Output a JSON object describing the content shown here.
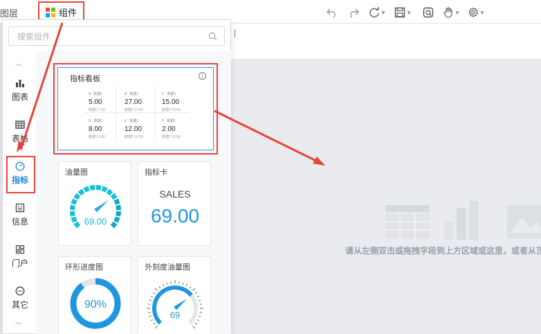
{
  "topbar": {
    "layers_label": "图层",
    "component_button_label": "组件",
    "tools": [
      "undo-icon",
      "redo-icon",
      "refresh-icon",
      "save-icon",
      "preview-icon",
      "hand-icon",
      "settings-icon"
    ]
  },
  "panel": {
    "search_placeholder": "搜索组件",
    "categories": [
      {
        "label": "图表",
        "icon": "chart-icon"
      },
      {
        "label": "表格",
        "icon": "table-icon"
      },
      {
        "label": "指标",
        "icon": "gauge-icon"
      },
      {
        "label": "信息",
        "icon": "info-icon"
      },
      {
        "label": "门户",
        "icon": "portal-icon"
      },
      {
        "label": "其它",
        "icon": "more-icon"
      }
    ],
    "active_category": "指标",
    "components": {
      "kpi_board": {
        "title": "指标看板",
        "cells": [
          {
            "letter": "A",
            "label": "数据1",
            "value": "5.00",
            "sub": "数据2 7.00"
          },
          {
            "letter": "B",
            "label": "数据1",
            "value": "27.00",
            "sub": "数据2 12.00"
          },
          {
            "letter": "C",
            "label": "数据1",
            "value": "15.00",
            "sub": "数据2 25.00"
          },
          {
            "letter": "D",
            "label": "数据1",
            "value": "8.00",
            "sub": "数据2 2.00"
          },
          {
            "letter": "E",
            "label": "数据1",
            "value": "12.00",
            "sub": "数据2 16.00"
          },
          {
            "letter": "F",
            "label": "数据1",
            "value": "2.00",
            "sub": "数据2 10.00"
          }
        ]
      },
      "gauge": {
        "title": "油量图",
        "value": "69.00",
        "fraction": 0.69
      },
      "metric_card": {
        "title": "指标卡",
        "caption": "SALES",
        "value": "69.00"
      },
      "ring_progress": {
        "title": "环形进度图",
        "value": "90%",
        "fraction": 0.9
      },
      "outer_scale_gauge": {
        "title": "外刻度油量图",
        "value": "69",
        "fraction": 0.69
      }
    }
  },
  "canvas": {
    "hint": "请从左侧双击或拖拽字段到上方区域或这里，或者从顶"
  },
  "colors": {
    "accent": "#1f86d6",
    "highlight": "#e8433a",
    "gauge_cyan": "#14c2d6",
    "metric_blue": "#1f97e0"
  }
}
